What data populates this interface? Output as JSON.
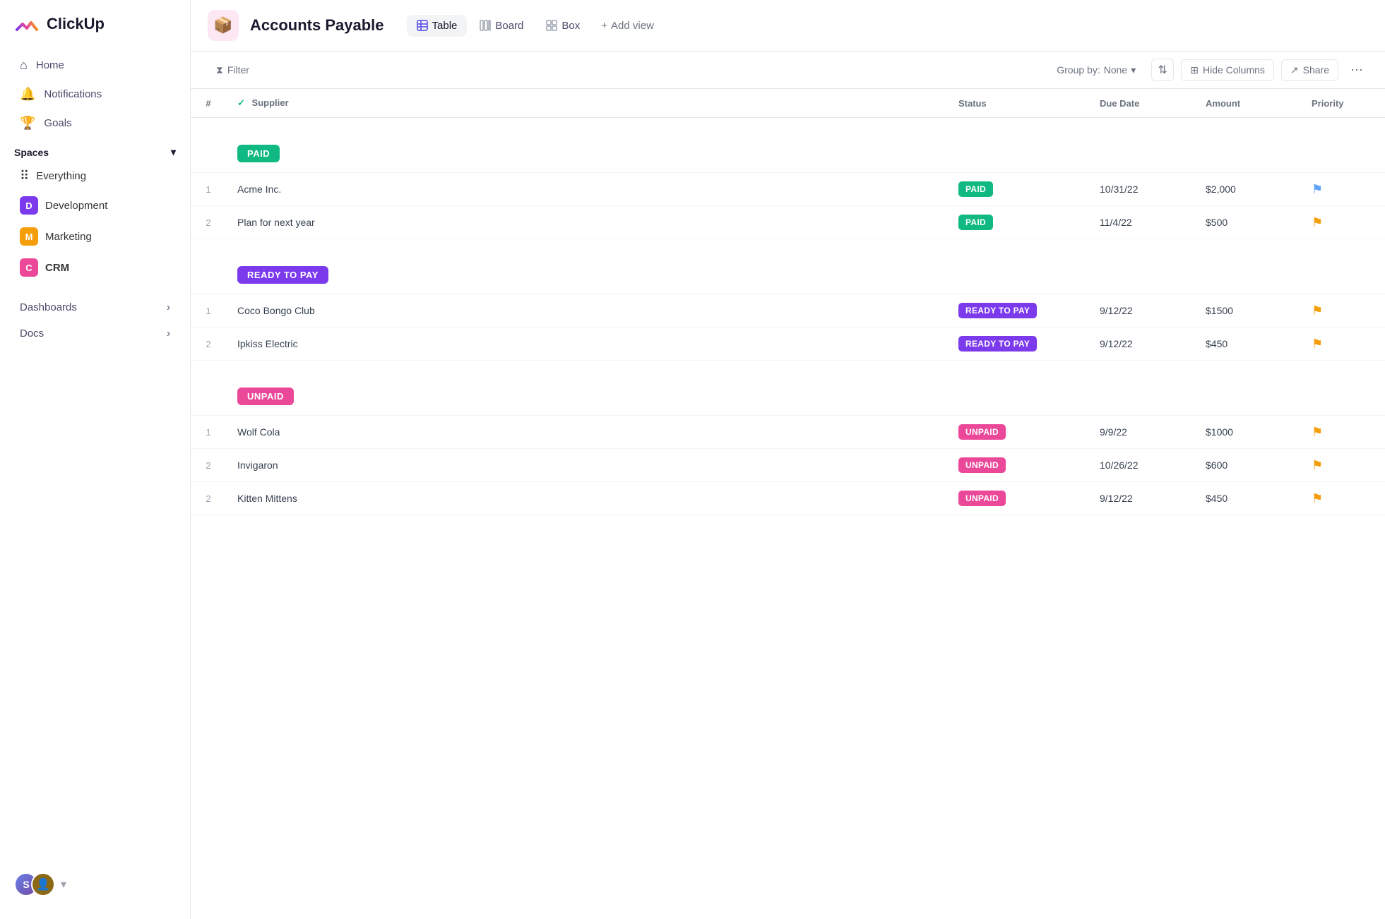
{
  "app": {
    "name": "ClickUp"
  },
  "sidebar": {
    "nav": [
      {
        "id": "home",
        "label": "Home",
        "icon": "⌂"
      },
      {
        "id": "notifications",
        "label": "Notifications",
        "icon": "🔔"
      },
      {
        "id": "goals",
        "label": "Goals",
        "icon": "🏆"
      }
    ],
    "spaces_label": "Spaces",
    "spaces": [
      {
        "id": "everything",
        "label": "Everything",
        "type": "everything"
      },
      {
        "id": "development",
        "label": "Development",
        "initial": "D",
        "color": "#7c3aed"
      },
      {
        "id": "marketing",
        "label": "Marketing",
        "initial": "M",
        "color": "#f59e0b"
      },
      {
        "id": "crm",
        "label": "CRM",
        "initial": "C",
        "color": "#ec4899",
        "bold": true
      }
    ],
    "sections": [
      {
        "id": "dashboards",
        "label": "Dashboards"
      },
      {
        "id": "docs",
        "label": "Docs"
      }
    ]
  },
  "header": {
    "page_title": "Accounts Payable",
    "views": [
      {
        "id": "table",
        "label": "Table",
        "active": true
      },
      {
        "id": "board",
        "label": "Board",
        "active": false
      },
      {
        "id": "box",
        "label": "Box",
        "active": false
      }
    ],
    "add_view_label": "Add view"
  },
  "toolbar": {
    "filter_label": "Filter",
    "group_by_label": "Group by:",
    "group_by_value": "None",
    "hide_columns_label": "Hide Columns",
    "share_label": "Share"
  },
  "table": {
    "columns": [
      {
        "id": "num",
        "label": "#"
      },
      {
        "id": "supplier",
        "label": "Supplier"
      },
      {
        "id": "status",
        "label": "Status"
      },
      {
        "id": "due_date",
        "label": "Due Date"
      },
      {
        "id": "amount",
        "label": "Amount"
      },
      {
        "id": "priority",
        "label": "Priority"
      }
    ],
    "groups": [
      {
        "id": "paid",
        "label": "PAID",
        "badge_class": "badge-paid",
        "rows": [
          {
            "num": "1",
            "supplier": "Acme Inc.",
            "status": "PAID",
            "status_class": "status-paid",
            "due_date": "10/31/22",
            "amount": "$2,000",
            "priority": "blue"
          },
          {
            "num": "2",
            "supplier": "Plan for next year",
            "status": "PAID",
            "status_class": "status-paid",
            "due_date": "11/4/22",
            "amount": "$500",
            "priority": "yellow"
          }
        ]
      },
      {
        "id": "ready",
        "label": "READY TO PAY",
        "badge_class": "badge-ready",
        "rows": [
          {
            "num": "1",
            "supplier": "Coco Bongo Club",
            "status": "READY TO PAY",
            "status_class": "status-ready",
            "due_date": "9/12/22",
            "amount": "$1500",
            "priority": "yellow"
          },
          {
            "num": "2",
            "supplier": "Ipkiss Electric",
            "status": "READY TO PAY",
            "status_class": "status-ready",
            "due_date": "9/12/22",
            "amount": "$450",
            "priority": "yellow"
          }
        ]
      },
      {
        "id": "unpaid",
        "label": "UNPAID",
        "badge_class": "badge-unpaid",
        "rows": [
          {
            "num": "1",
            "supplier": "Wolf Cola",
            "status": "UNPAID",
            "status_class": "status-unpaid",
            "due_date": "9/9/22",
            "amount": "$1000",
            "priority": "yellow"
          },
          {
            "num": "2",
            "supplier": "Invigaron",
            "status": "UNPAID",
            "status_class": "status-unpaid",
            "due_date": "10/26/22",
            "amount": "$600",
            "priority": "yellow"
          },
          {
            "num": "2",
            "supplier": "Kitten Mittens",
            "status": "UNPAID",
            "status_class": "status-unpaid",
            "due_date": "9/12/22",
            "amount": "$450",
            "priority": "yellow"
          }
        ]
      }
    ]
  }
}
